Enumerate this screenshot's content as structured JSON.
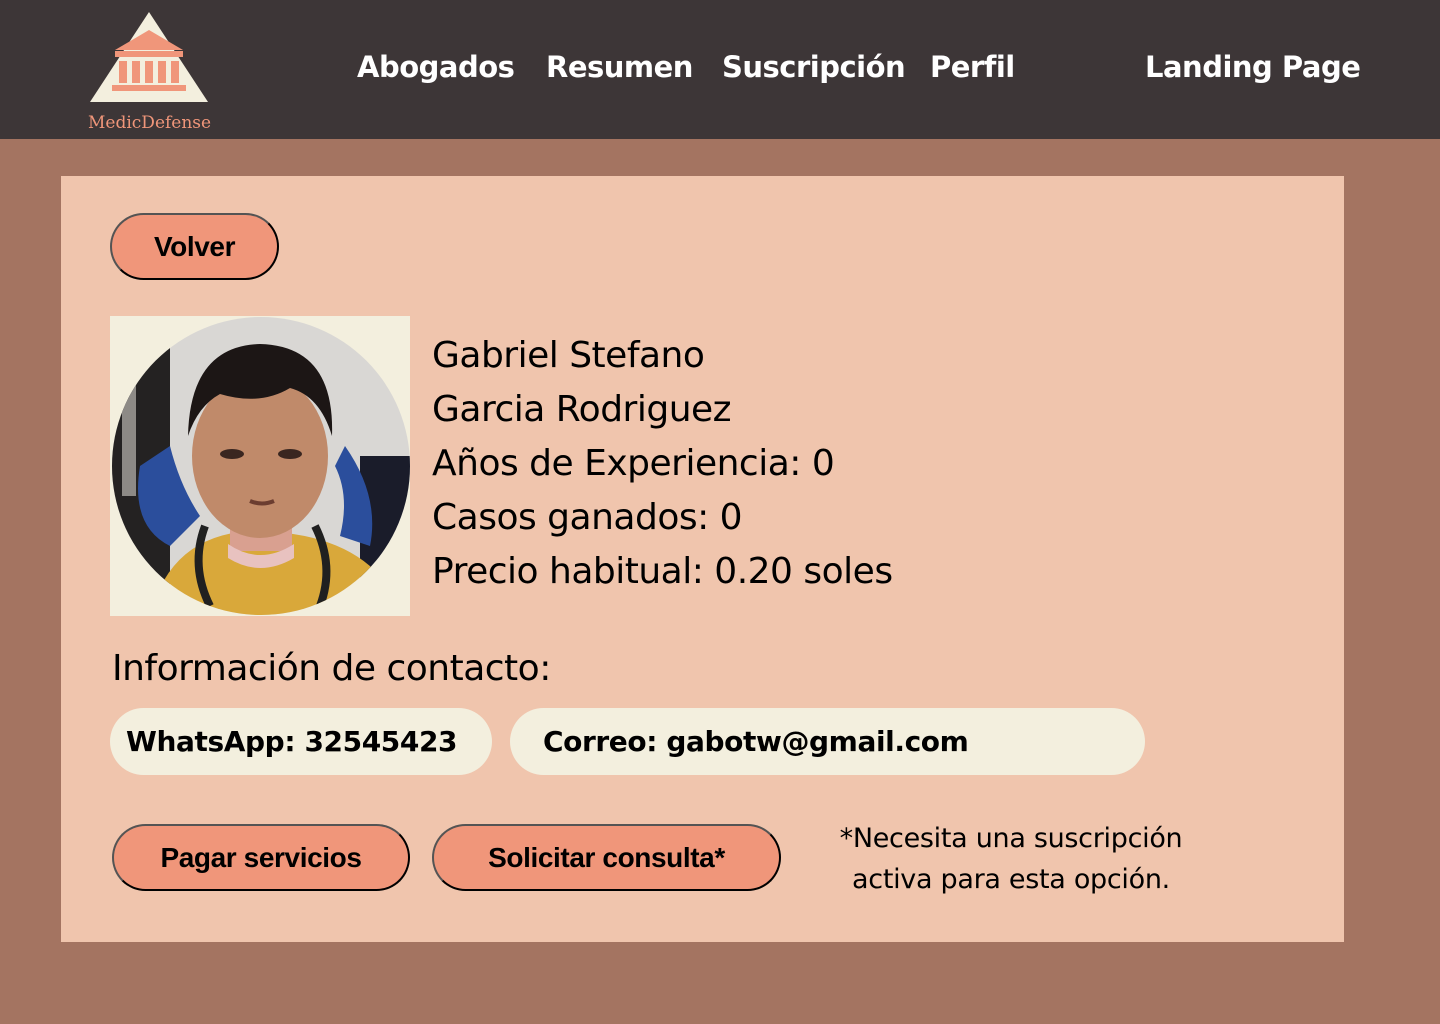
{
  "brand": {
    "name": "MedicDefense",
    "icon": "courthouse-icon",
    "colors": {
      "accent": "#f0967a",
      "badge": "#f3efde",
      "header": "#3d3637"
    }
  },
  "nav": {
    "abogados": "Abogados",
    "resumen": "Resumen",
    "suscripcion": "Suscripción",
    "perfil": "Perfil",
    "landing": "Landing Page"
  },
  "page": {
    "back_label": "Volver",
    "profile": {
      "first_names": "Gabriel Stefano",
      "last_names": "Garcia Rodriguez",
      "experience": "Años de Experiencia: 0",
      "cases_won": "Casos ganados: 0",
      "price": "Precio habitual: 0.20 soles"
    },
    "contact": {
      "title": "Información de contacto:",
      "whatsapp": "WhatsApp: 32545423",
      "email": "Correo: gabotw@gmail.com"
    },
    "actions": {
      "pay": "Pagar servicios",
      "consult": "Solicitar consulta*"
    },
    "note_line1": "*Necesita una suscripción",
    "note_line2": "activa para esta opción."
  }
}
